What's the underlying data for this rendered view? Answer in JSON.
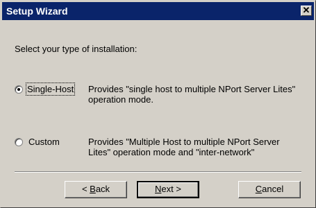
{
  "window": {
    "title": "Setup Wizard",
    "close_glyph": "✕"
  },
  "prompt": "Select your type of installation:",
  "options": [
    {
      "label": "Single-Host",
      "selected": true,
      "description_line1": "Provides \"single host to multiple NPort Server Lites\"",
      "description_line2": "operation mode."
    },
    {
      "label": "Custom",
      "selected": false,
      "description_line1": "Provides \"Multiple Host to multiple NPort Server",
      "description_line2": "Lites\" operation mode and \"inter-network\""
    }
  ],
  "buttons": {
    "back": {
      "pre": "< ",
      "accel": "B",
      "post": "ack"
    },
    "next": {
      "accel": "N",
      "post": "ext >"
    },
    "cancel": {
      "accel": "C",
      "post": "ancel"
    }
  },
  "colors": {
    "titlebar": "#0a246a",
    "face": "#d4d0c8"
  }
}
